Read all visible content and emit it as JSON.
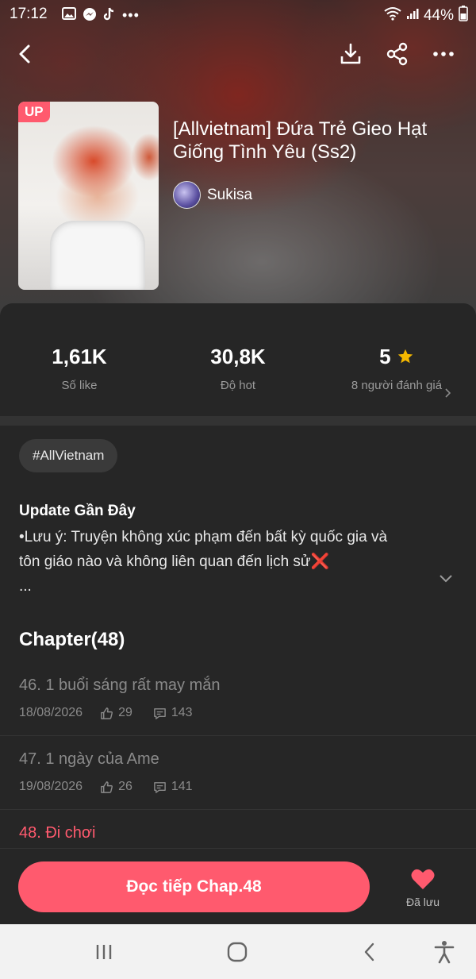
{
  "status_bar": {
    "time": "17:12",
    "battery": "44%"
  },
  "header": {
    "back_icon": "back-arrow-icon",
    "download_icon": "download-icon",
    "share_icon": "share-icon",
    "more_icon": "more-icon"
  },
  "book": {
    "badge": "UP",
    "title": "[Allvietnam] Đứa Trẻ Gieo Hạt Giống Tình Yêu (Ss2)",
    "author": "Sukisa"
  },
  "stats": [
    {
      "value": "1,61K",
      "label": "Số like"
    },
    {
      "value": "30,8K",
      "label": "Độ hot"
    },
    {
      "value": "5",
      "label": "8 người đánh giá"
    }
  ],
  "tag": "#AllVietnam",
  "update": {
    "title": "Update Gần Đây",
    "line1": "•Lưu ý: Truyện không xúc phạm đến bất kỳ quốc gia và",
    "line2": "tôn giáo nào và không liên quan đến lịch sử❌",
    "ellipsis": "..."
  },
  "chapters_header": "Chapter(48)",
  "chapters": [
    {
      "title": "46. 1 buổi sáng rất may mắn",
      "date": "18/08/2026",
      "likes": "29",
      "comments": "143"
    },
    {
      "title": "47. 1 ngày của Ame",
      "date": "19/08/2026",
      "likes": "26",
      "comments": "141"
    },
    {
      "title": "48. Đi chơi"
    }
  ],
  "actions": {
    "read_button": "Đọc tiếp Chap.48",
    "saved_label": "Đã lưu"
  },
  "colors": {
    "accent": "#ff5a6e",
    "background": "#262626",
    "star": "#f5b800"
  }
}
